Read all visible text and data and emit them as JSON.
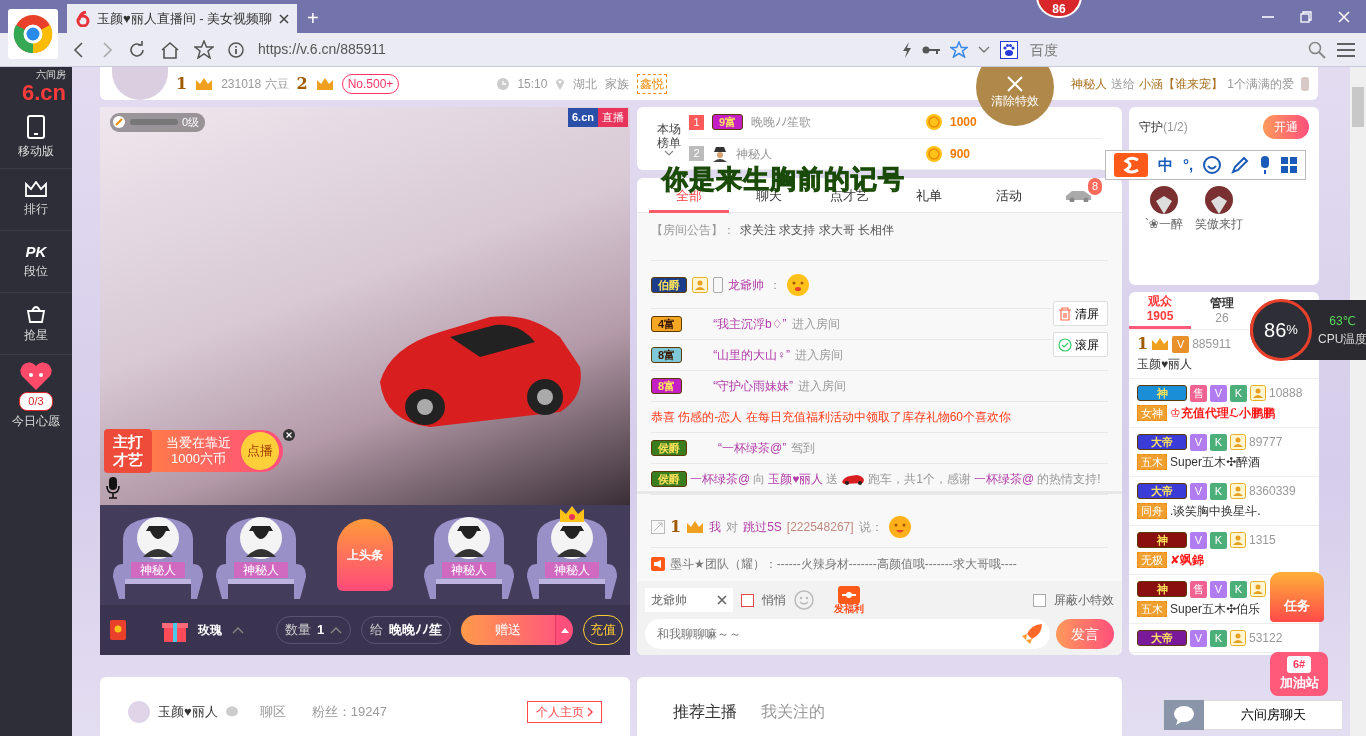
{
  "browser": {
    "tab_title": "玉颜♥丽人直播间 - 美女视频聊",
    "new_tab": "+",
    "notification_count": "86",
    "url": "https://v.6.cn/885911",
    "search_placeholder": "百度"
  },
  "sidebar": {
    "logo_text": "6.cn",
    "logo_sub": "六间房",
    "items": [
      {
        "kind": "phone",
        "label": "移动版"
      },
      {
        "kind": "crown",
        "label": "排行"
      },
      {
        "kind": "pk",
        "icon_text": "PK",
        "label": "段位"
      },
      {
        "kind": "bag",
        "label": "抢星"
      }
    ],
    "wish": {
      "count": "0/3",
      "label": "今日心愿"
    }
  },
  "header": {
    "wealth_level": "1",
    "beans": "231018 六豆",
    "star_level": "2",
    "rank": "No.500+",
    "time": "15:10",
    "location": "湖北",
    "family_label": "家族",
    "family": "鑫悦",
    "gift_notice": {
      "sender": "神秘人",
      "verb": "送给",
      "receiver": "小涵【谁来宠】",
      "gift": "1个满满的爱"
    }
  },
  "clear_effects": {
    "label": "清除特效"
  },
  "video": {
    "brand": "6.cn",
    "live": "直播",
    "level_label": "0级",
    "level": 0,
    "promo": {
      "tag": "主打才艺",
      "song": "当爱在靠近",
      "price": "1000六币",
      "action": "点播"
    }
  },
  "seats": [
    {
      "kind": "user",
      "name": "神秘人",
      "crowned": false
    },
    {
      "kind": "user",
      "name": "神秘人",
      "crowned": false
    },
    {
      "kind": "headline",
      "name": "上头条",
      "crowned": false
    },
    {
      "kind": "user",
      "name": "神秘人",
      "crowned": false
    },
    {
      "kind": "user",
      "name": "神秘人",
      "crowned": true
    }
  ],
  "gift_bar": {
    "gift": "玫瑰",
    "quantity_label": "数量",
    "quantity": "1",
    "to_label": "给",
    "recipient": "晚晚ﾉﾉ笙",
    "send": "赠送",
    "recharge": "充值"
  },
  "ranking": {
    "title": "本场榜单",
    "rows": [
      {
        "rank": "1",
        "kind": "rich",
        "badge": {
          "text": "9富",
          "color": "#c41fc4"
        },
        "name": "晚晚ﾉﾉ笙歌",
        "coins": "1000"
      },
      {
        "rank": "2",
        "kind": "anonymous",
        "name": "神秘人",
        "coins": "900"
      }
    ]
  },
  "lyrics": "你是来生胸前的记号",
  "ime_toolbar": {
    "mode": "中",
    "punct": "°,"
  },
  "chat": {
    "tabs": [
      {
        "label": "全部",
        "selected": true
      },
      {
        "label": "聊天",
        "selected": false
      },
      {
        "label": "点才艺",
        "selected": false
      },
      {
        "label": "礼单",
        "selected": false
      },
      {
        "label": "活动",
        "selected": false
      }
    ],
    "car_count": "8",
    "notice": {
      "label": "【房间公告】：",
      "text": "求关注 求支持 求大哥 长相伴"
    },
    "messages": [
      {
        "kind": "chat",
        "badge": {
          "text": "伯爵",
          "color": "#1e3c8c"
        },
        "fan": true,
        "mobile": true,
        "user": "龙爺帅",
        "colon": "："
      },
      {
        "kind": "enter",
        "badge": {
          "text": "4富",
          "color": "#f5a623"
        },
        "user": "“我主沉浮b♢”",
        "action": "进入房间"
      },
      {
        "kind": "enter",
        "badge": {
          "text": "8富",
          "color": "#7ec8d8"
        },
        "user": "“山里的大山♀”",
        "action": "进入房间"
      },
      {
        "kind": "enter",
        "badge": {
          "text": "8富",
          "color": "#c41fc4"
        },
        "user": "“守护心雨妹妹”",
        "action": "进入房间"
      },
      {
        "kind": "system",
        "text": "恭喜 伤感的-恋人 在每日充值福利活动中领取了库存礼物60个喜欢你"
      },
      {
        "kind": "enter",
        "badge": {
          "text": "侯爵",
          "color": "#3a7d1e"
        },
        "user": "“一杯绿茶@”",
        "action": "驾到"
      },
      {
        "kind": "gift",
        "badge": {
          "text": "侯爵",
          "color": "#3a7d1e"
        },
        "sender": "一杯绿茶@",
        "to": "向",
        "receiver": "玉颜♥丽人",
        "send": "送",
        "gift": "跑车，共1个，感谢",
        "thanked": "一杯绿茶@",
        "tail": "的热情支持!"
      }
    ],
    "side_buttons": [
      {
        "kind": "trash",
        "label": "清屏"
      },
      {
        "kind": "check",
        "label": "滚屏"
      }
    ],
    "private_messages": [
      {
        "kind": "whisper",
        "level": "1",
        "me": "我",
        "to": "对",
        "target": "跳过5S",
        "id": "[222548267]",
        "say": "说："
      },
      {
        "kind": "broadcast",
        "text": "墨斗★团队（耀）：------火辣身材-------高颜值哦-------求大哥哦----"
      }
    ],
    "composer": {
      "target": "龙爺帅",
      "whisper_label": "悄悄",
      "whisper": false,
      "welfare": "发福利",
      "block_effects_label": "屏蔽小特效",
      "block_effects": false,
      "placeholder": "和我聊聊嘛～～",
      "send": "发言"
    }
  },
  "guard": {
    "title": "守护",
    "count": "(1/2)",
    "open": "开通",
    "members": [
      "`❀一醉",
      "笑傲来打"
    ]
  },
  "audience": {
    "tabs": [
      {
        "label": "观众",
        "count": "1905",
        "selected": true
      },
      {
        "label": "管理",
        "count": "26",
        "selected": false
      }
    ],
    "users": [
      {
        "level": "1",
        "badges": [
          {
            "kind": "text",
            "text": "V",
            "color": "#e8902a"
          }
        ],
        "id": "885911",
        "name": "玉颜♥丽人",
        "vip_name": false
      },
      {
        "rank_badge": {
          "text": "神",
          "color": "#1a8fd8"
        },
        "badges": [
          {
            "kind": "text",
            "text": "售",
            "color": "#f06292"
          },
          {
            "kind": "text",
            "text": "V",
            "color": "#b07cf0"
          },
          {
            "kind": "text",
            "text": "K",
            "color": "#4caf7a"
          },
          {
            "kind": "fan"
          }
        ],
        "id": "10888",
        "tag": "女神",
        "name": "♔充值代理ℒ小鹏鹏",
        "vip_name": true
      },
      {
        "rank_badge": {
          "text": "大帝",
          "color": "#3b3bd8"
        },
        "badges": [
          {
            "kind": "text",
            "text": "V",
            "color": "#b07cf0"
          },
          {
            "kind": "text",
            "text": "K",
            "color": "#4caf7a"
          },
          {
            "kind": "fan"
          }
        ],
        "id": "89777",
        "tag": "五木",
        "name": "Super五木✣醉酒",
        "vip_name": false
      },
      {
        "rank_badge": {
          "text": "大帝",
          "color": "#3b3bd8"
        },
        "badges": [
          {
            "kind": "text",
            "text": "V",
            "color": "#b07cf0"
          },
          {
            "kind": "text",
            "text": "K",
            "color": "#4caf7a"
          },
          {
            "kind": "fan"
          }
        ],
        "id": "8360339",
        "tag": "同舟",
        "name": ".谈笑胸中换星斗.",
        "vip_name": false
      },
      {
        "rank_badge": {
          "text": "神",
          "color": "#8a1010"
        },
        "badges": [
          {
            "kind": "text",
            "text": "V",
            "color": "#b07cf0"
          },
          {
            "kind": "text",
            "text": "K",
            "color": "#4caf7a"
          },
          {
            "kind": "fan"
          }
        ],
        "id": "1315",
        "tag": "无极",
        "name": "✘飒錦",
        "vip_name": true
      },
      {
        "rank_badge": {
          "text": "神",
          "color": "#8a1010"
        },
        "badges": [
          {
            "kind": "text",
            "text": "售",
            "color": "#f06292"
          },
          {
            "kind": "text",
            "text": "V",
            "color": "#b07cf0"
          },
          {
            "kind": "text",
            "text": "K",
            "color": "#4caf7a"
          },
          {
            "kind": "fan"
          }
        ],
        "tag": "五木",
        "name": "Super五木✣伯乐",
        "vip_name": false
      },
      {
        "rank_badge": {
          "text": "大帝",
          "color": "#7a1a9a"
        },
        "badges": [
          {
            "kind": "text",
            "text": "V",
            "color": "#b07cf0"
          },
          {
            "kind": "text",
            "text": "K",
            "color": "#4caf7a"
          },
          {
            "kind": "fan"
          }
        ],
        "id": "53122",
        "vip_name": false
      }
    ]
  },
  "cpu": {
    "percent": "86",
    "unit": "%",
    "temp": "63℃",
    "label": "CPU温度"
  },
  "floating": {
    "task": "任务",
    "station_number": "6#",
    "station": "加油站",
    "chat_button": "六间房聊天"
  },
  "profile": {
    "name": "玉颜♥丽人",
    "zone": "聊区",
    "fans": "粉丝：19247",
    "homepage": "个人主页"
  },
  "recommend_tabs": [
    {
      "label": "推荐主播",
      "selected": true
    },
    {
      "label": "我关注的",
      "selected": false
    }
  ]
}
